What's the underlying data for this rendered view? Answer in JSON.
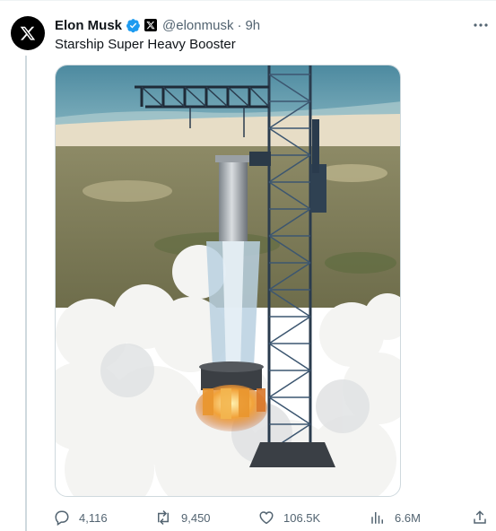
{
  "tweet": {
    "author_name": "Elon Musk",
    "handle": "@elonmusk",
    "separator": "·",
    "time": "9h",
    "text": "Starship Super Heavy Booster"
  },
  "metrics": {
    "replies": "4,116",
    "reposts": "9,450",
    "likes": "106.5K",
    "views": "6.6M"
  },
  "icons": [
    "x-logo-icon",
    "verified-badge-icon",
    "affiliate-x-icon",
    "more-icon",
    "reply-icon",
    "repost-icon",
    "like-icon",
    "views-icon",
    "share-icon"
  ],
  "colors": {
    "verified": "#1d9bf0",
    "secondary_text": "#536471",
    "thread_line": "#cfd9de"
  }
}
